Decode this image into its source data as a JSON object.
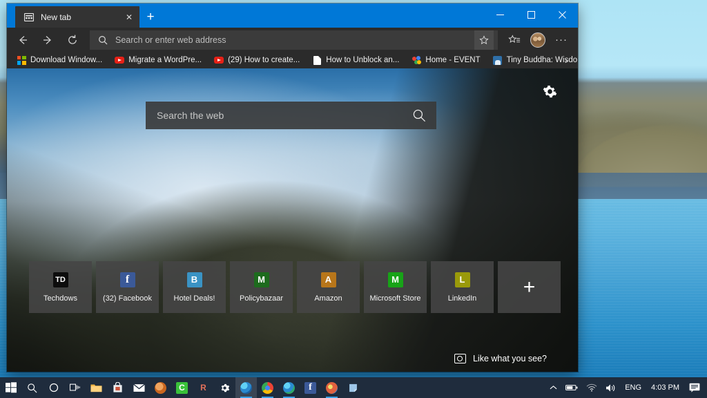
{
  "window": {
    "title": "New tab",
    "controls": {
      "minimize": "—",
      "maximize": "☐",
      "close": "✕"
    }
  },
  "tab": {
    "title": "New tab",
    "close_label": "✕",
    "favicon": "new-tab-icon",
    "newtab_label": "+"
  },
  "navbar": {
    "back_label": "←",
    "forward_label": "→",
    "refresh_label": "↻",
    "search_icon": "search-icon",
    "address_placeholder": "Search or enter web address",
    "address_value": "",
    "favorite_label": "☆",
    "hub_label": "favorites-hub-icon",
    "profile_label": "profile-avatar",
    "more_label": "···"
  },
  "bookmarks": {
    "overflow_label": "›",
    "items": [
      {
        "label": "Download Window...",
        "icon": "windows-icon"
      },
      {
        "label": "Migrate a WordPre...",
        "icon": "youtube-icon"
      },
      {
        "label": "(29) How to create...",
        "icon": "youtube-icon"
      },
      {
        "label": "How to Unblock an...",
        "icon": "document-icon"
      },
      {
        "label": "Home - EVENT",
        "icon": "event-icon"
      },
      {
        "label": "Tiny Buddha: Wisdo...",
        "icon": "tinybuddha-icon"
      }
    ]
  },
  "newtab": {
    "settings_label": "gear-icon",
    "search_placeholder": "Search the web",
    "search_value": "",
    "search_icon": "search-icon",
    "feedback_label": "Like what you see?",
    "feedback_icon": "camera-icon",
    "add_tile_label": "+",
    "tiles": [
      {
        "label": "Techdows",
        "initial": "TD",
        "color": "#0d0d0d"
      },
      {
        "label": "(32) Facebook",
        "initial": "f",
        "color": "#3b5998"
      },
      {
        "label": "Hotel Deals!",
        "initial": "B",
        "color": "#3a93c4"
      },
      {
        "label": "Policybazaar",
        "initial": "M",
        "color": "#1d6b1d"
      },
      {
        "label": "Amazon",
        "initial": "A",
        "color": "#b8761a"
      },
      {
        "label": "Microsoft Store",
        "initial": "M",
        "color": "#17a317"
      },
      {
        "label": "LinkedIn",
        "initial": "L",
        "color": "#9a9a0a"
      }
    ]
  },
  "taskbar": {
    "items": [
      {
        "name": "start",
        "glyph": "⊞",
        "color": "#ffffff",
        "active": false,
        "open": false
      },
      {
        "name": "search",
        "glyph": "⚲",
        "color": "#ffffff",
        "active": false,
        "open": false
      },
      {
        "name": "cortana",
        "glyph": "◯",
        "color": "#ffffff",
        "active": false,
        "open": false
      },
      {
        "name": "task-view",
        "glyph": "⌸",
        "color": "#ffffff",
        "active": false,
        "open": false
      },
      {
        "name": "file-explorer",
        "glyph": "▤",
        "color": "#f2b441",
        "active": false,
        "open": false
      },
      {
        "name": "microsoft-store",
        "glyph": "▣",
        "color": "#e8e8e8",
        "active": false,
        "open": false
      },
      {
        "name": "mail",
        "glyph": "✉",
        "color": "#ffffff",
        "active": false,
        "open": false
      },
      {
        "name": "app-orange",
        "glyph": "⚙",
        "color": "#d4782a",
        "active": false,
        "open": false
      },
      {
        "name": "app-green",
        "glyph": "C",
        "color": "#3ac13a",
        "active": false,
        "open": false
      },
      {
        "name": "app-jr",
        "glyph": "R",
        "color": "#d6583a",
        "active": false,
        "open": false
      },
      {
        "name": "settings",
        "glyph": "⚙",
        "color": "#ffffff",
        "active": false,
        "open": false
      },
      {
        "name": "microsoft-edge",
        "glyph": "e",
        "color": "#3a8fd4",
        "active": true,
        "open": true
      },
      {
        "name": "google-chrome",
        "glyph": "◉",
        "color": "#f2b441",
        "active": false,
        "open": true
      },
      {
        "name": "edge-dev",
        "glyph": "e",
        "color": "#2fa86a",
        "active": false,
        "open": true
      },
      {
        "name": "facebook",
        "glyph": "f",
        "color": "#3b5998",
        "active": false,
        "open": false
      },
      {
        "name": "paint",
        "glyph": "✎",
        "color": "#d4643a",
        "active": false,
        "open": true
      },
      {
        "name": "sticky-notes",
        "glyph": "▱",
        "color": "#8ab4dd",
        "active": false,
        "open": false
      }
    ],
    "tray": {
      "chevron": "∧",
      "battery": "battery-icon",
      "network": "wifi-icon",
      "volume": "volume-icon",
      "language": "ENG",
      "time": "4:03 PM",
      "action_center": "notifications-icon"
    }
  }
}
